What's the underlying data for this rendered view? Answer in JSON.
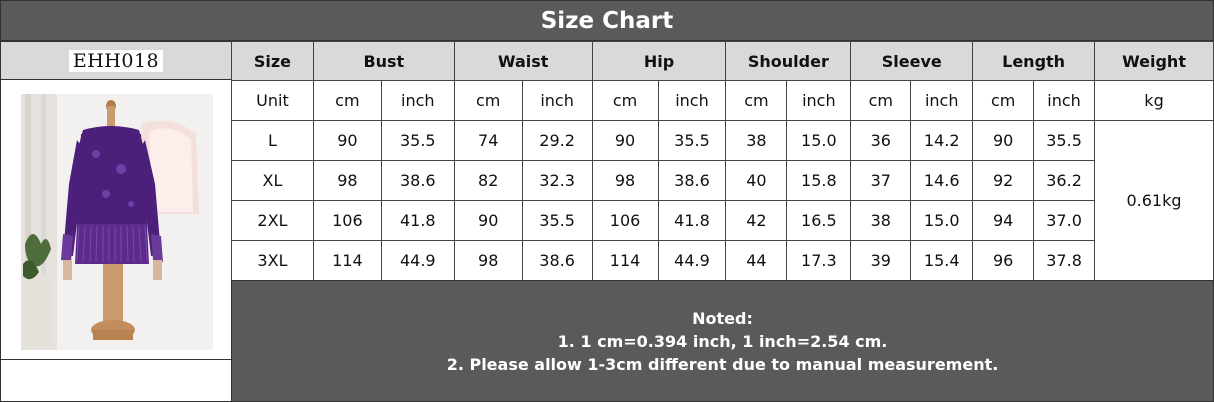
{
  "title": "Size Chart",
  "product_code": "EHH018",
  "table": {
    "headers": [
      "Size",
      "Bust",
      "Waist",
      "Hip",
      "Shoulder",
      "Sleeve",
      "Length",
      "Weight"
    ],
    "unit_row": [
      "Unit",
      "cm",
      "inch",
      "cm",
      "inch",
      "cm",
      "inch",
      "cm",
      "inch",
      "cm",
      "inch",
      "cm",
      "inch",
      "kg"
    ],
    "rows": [
      [
        "L",
        "90",
        "35.5",
        "74",
        "29.2",
        "90",
        "35.5",
        "38",
        "15.0",
        "36",
        "14.2",
        "90",
        "35.5"
      ],
      [
        "XL",
        "98",
        "38.6",
        "82",
        "32.3",
        "98",
        "38.6",
        "40",
        "15.8",
        "37",
        "14.6",
        "92",
        "36.2"
      ],
      [
        "2XL",
        "106",
        "41.8",
        "90",
        "35.5",
        "106",
        "41.8",
        "42",
        "16.5",
        "38",
        "15.0",
        "94",
        "37.0"
      ],
      [
        "3XL",
        "114",
        "44.9",
        "98",
        "38.6",
        "114",
        "44.9",
        "44",
        "17.3",
        "39",
        "15.4",
        "96",
        "37.8"
      ]
    ],
    "weight": "0.61kg"
  },
  "notes": {
    "heading": "Noted:",
    "line1": "1. 1 cm=0.394 inch, 1 inch=2.54 cm.",
    "line2": "2. Please allow 1-3cm different due to manual measurement."
  },
  "colors": {
    "header_bg": "#5a5a5a",
    "label_bg": "#d9d9d9",
    "dress": "#4b1f7a"
  }
}
